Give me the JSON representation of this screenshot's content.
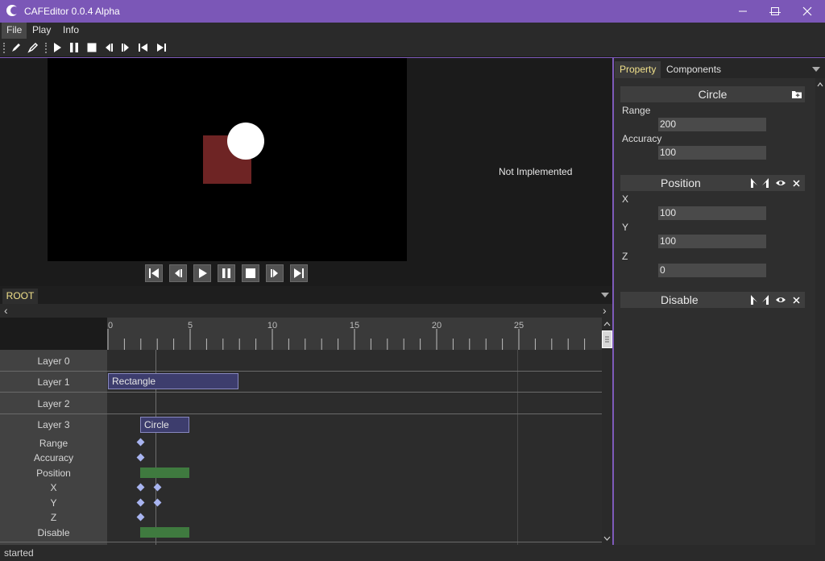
{
  "window": {
    "title": "CAFEditor 0.0.4 Alpha",
    "minimize": "—",
    "maximize": "☐",
    "close": "✕"
  },
  "menu": {
    "file": "File",
    "play": "Play",
    "info": "Info"
  },
  "viewport": {
    "placeholder_text": "Not Implemented"
  },
  "timeline": {
    "tab": "ROOT",
    "ruler_labels": [
      "0",
      "5",
      "10",
      "15",
      "20",
      "25"
    ],
    "rows": {
      "layer0": "Layer 0",
      "layer1": "Layer 1",
      "layer2": "Layer 2",
      "layer3": "Layer 3",
      "range": "Range",
      "accuracy": "Accuracy",
      "position": "Position",
      "x": "X",
      "y": "Y",
      "z": "Z",
      "disable": "Disable"
    },
    "clips": {
      "rectangle": "Rectangle",
      "circle": "Circle"
    }
  },
  "right_panel": {
    "tabs": {
      "property": "Property",
      "components": "Components"
    },
    "circle": {
      "title": "Circle",
      "range_label": "Range",
      "range_value": "200",
      "accuracy_label": "Accuracy",
      "accuracy_value": "100"
    },
    "position": {
      "title": "Position",
      "x_label": "X",
      "x_value": "100",
      "y_label": "Y",
      "y_value": "100",
      "z_label": "Z",
      "z_value": "0"
    },
    "disable": {
      "title": "Disable"
    }
  },
  "status": {
    "text": "started"
  },
  "colors": {
    "accent": "#7b57b7",
    "active_tab": "#f0e08a",
    "clip": "#3d3d6d",
    "green_track": "#3f7a3f",
    "keyframe": "#a8b4f0"
  }
}
